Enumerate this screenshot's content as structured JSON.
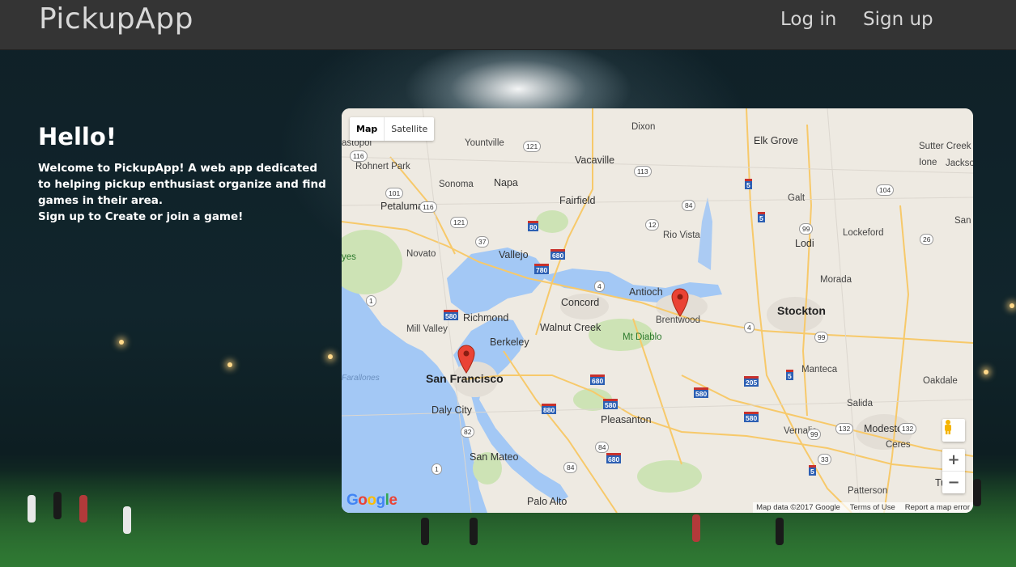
{
  "navbar": {
    "brand": "PickupApp",
    "login_label": "Log in",
    "signup_label": "Sign up"
  },
  "intro": {
    "heading": "Hello!",
    "welcome": "Welcome to PickupApp! A web app dedicated to helping pickup enthusiast organize and find games in their area.",
    "cta": "Sign up to Create or join a game!"
  },
  "map": {
    "type_map_label": "Map",
    "type_satellite_label": "Satellite",
    "zoom_in_label": "+",
    "zoom_out_label": "−",
    "logo_text": "Google",
    "attribution": {
      "data": "Map data ©2017 Google",
      "terms": "Terms of Use",
      "report": "Report a map error"
    },
    "places": {
      "san_francisco": "San Francisco",
      "stockton": "Stockton",
      "brentwood": "Brentwood",
      "richmond": "Richmond",
      "berkeley": "Berkeley",
      "concord": "Concord",
      "walnut_creek": "Walnut Creek",
      "mt_diablo": "Mt Diablo",
      "antioch": "Antioch",
      "pleasanton": "Pleasanton",
      "daly_city": "Daly City",
      "san_mateo": "San Mateo",
      "palo_alto": "Palo Alto",
      "vallejo": "Vallejo",
      "napa": "Napa",
      "fairfield": "Fairfield",
      "vacaville": "Vacaville",
      "dixon": "Dixon",
      "elk_grove": "Elk Grove",
      "lodi": "Lodi",
      "manteca": "Manteca",
      "modesto": "Modesto",
      "tracy": "Tracy",
      "petaluma": "Petaluma",
      "novato": "Novato",
      "mill_valley": "Mill Valley",
      "sonoma": "Sonoma",
      "yountville": "Yountville",
      "rohnert_park": "Rohnert Park",
      "rio_vista": "Rio Vista",
      "galt": "Galt",
      "lockeford": "Lockeford",
      "morada": "Morada",
      "oakdale": "Oakdale",
      "salida": "Salida",
      "ceres": "Ceres",
      "patterson": "Patterson",
      "turlock": "Turloc",
      "vernalis": "Vernalis",
      "sutter_creek": "Sutter Creek",
      "ione": "Ione",
      "jackson": "Jackson",
      "san_a": "San A",
      "farallones": "Farallones",
      "petaluma_pt": "astopol",
      "yes": "yes"
    },
    "markers": [
      "San Francisco",
      "Brentwood"
    ]
  }
}
